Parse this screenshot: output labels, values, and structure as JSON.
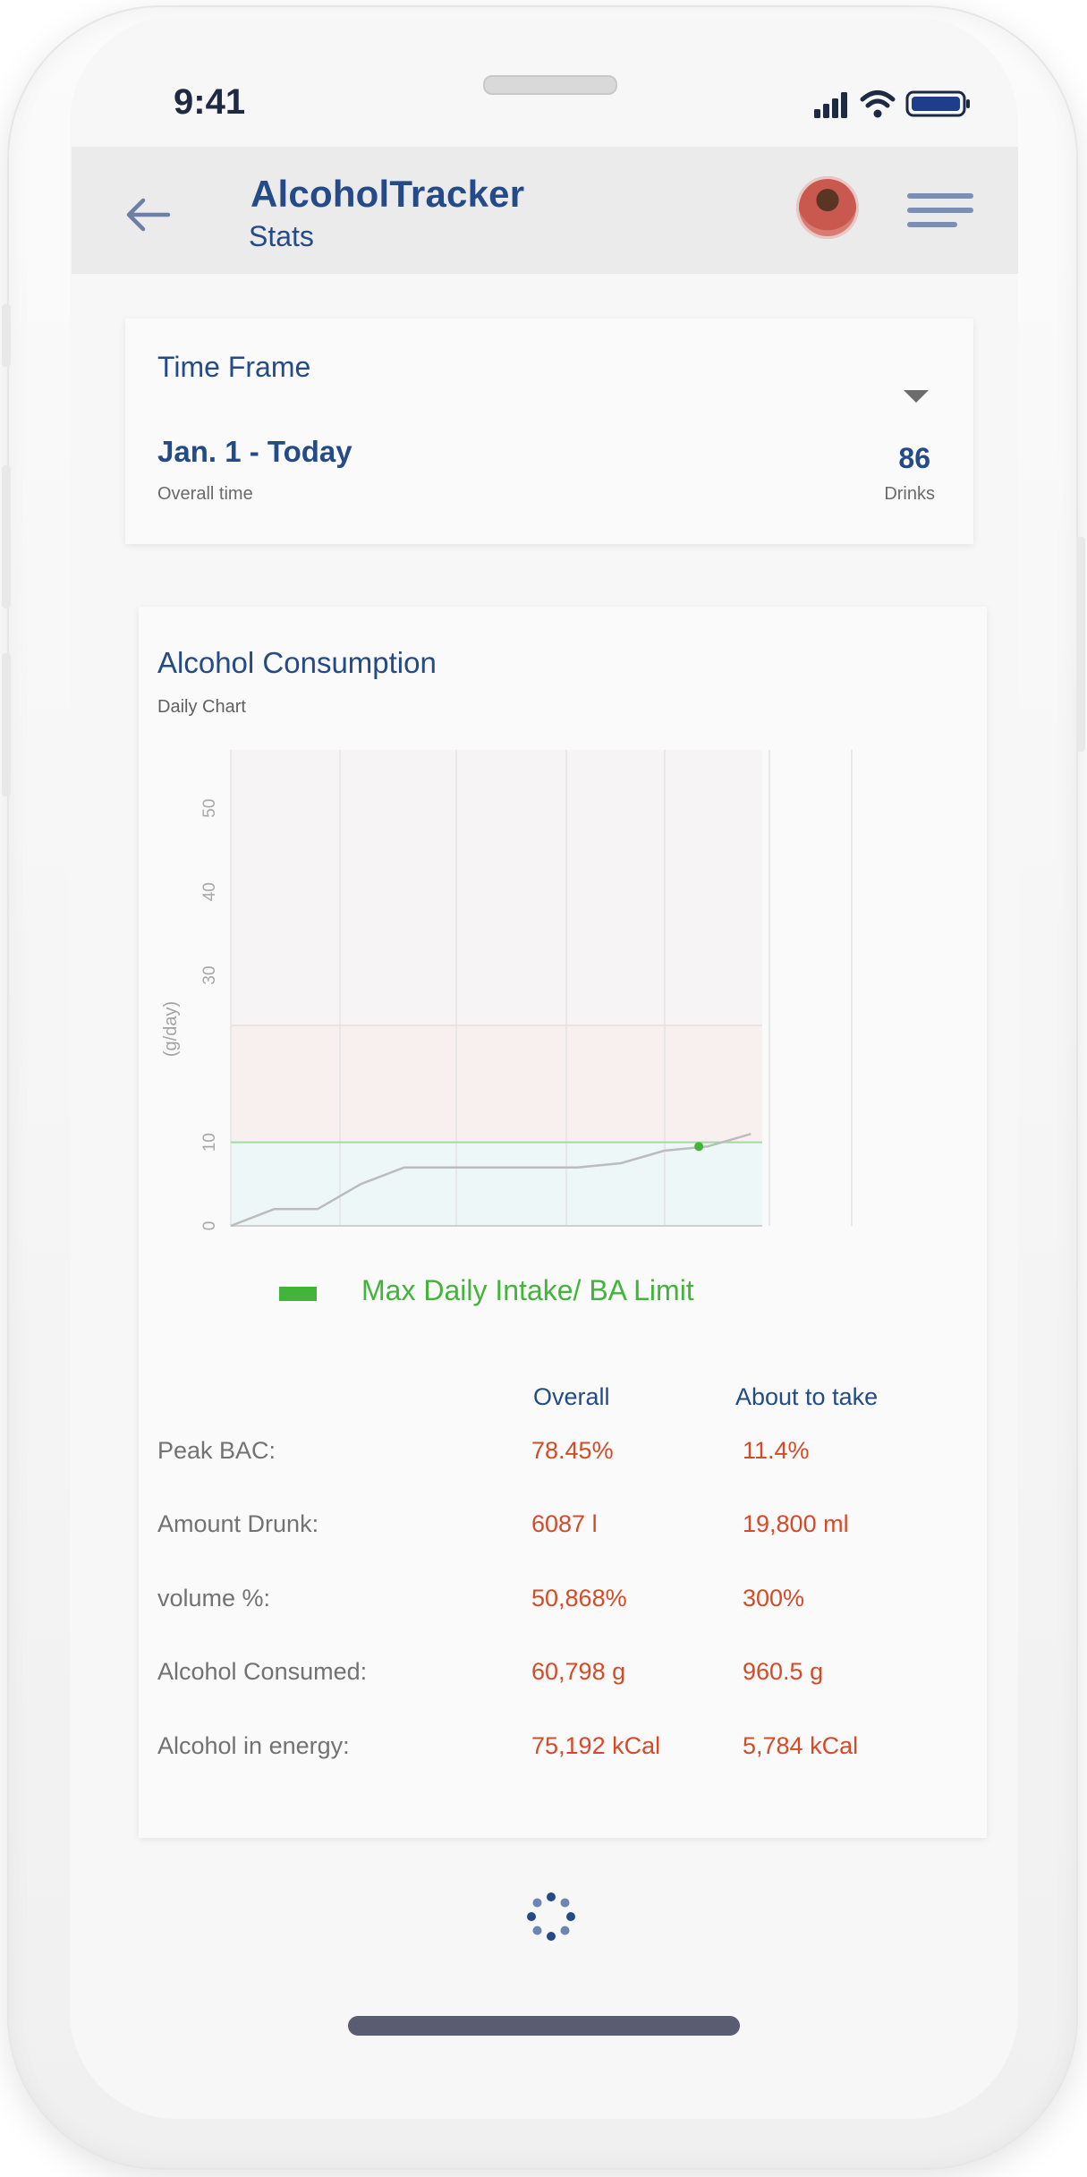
{
  "status_bar": {
    "time": "9:41"
  },
  "header": {
    "title": "AlcoholTracker",
    "subtitle": "Stats",
    "icons": [
      "back-arrow-icon",
      "avatar",
      "hamburger-menu-icon"
    ]
  },
  "time_frame": {
    "label": "Time Frame",
    "range": "Jan. 1 - Today",
    "range_caption": "Overall time",
    "count": "86",
    "count_caption": "Drinks"
  },
  "consumption": {
    "title": "Alcohol Consumption",
    "subtitle": "Daily Chart",
    "legend_label": "Max Daily Intake/ BA Limit",
    "legend_color": "#43b43a"
  },
  "chart_data": {
    "type": "line",
    "ylabel": "(g/day)",
    "yticks": [
      0,
      10,
      30,
      40,
      50
    ],
    "ylim": [
      0,
      57
    ],
    "limit_value": 10,
    "upper_band_value": 24,
    "x": [
      0,
      1,
      2,
      3,
      4,
      5,
      6,
      7,
      8,
      9,
      10,
      11,
      12
    ],
    "values": [
      0,
      2,
      2,
      5,
      7,
      7,
      7,
      7,
      7,
      7.5,
      9,
      9.5,
      11
    ],
    "highlight_point": {
      "x": 10.8,
      "y": 9.5
    },
    "grid": "vertical",
    "colors": {
      "line": "#bcbcbc",
      "limit_line": "#a6d8a1",
      "safe_band": "#eef7f8",
      "warning_band": "#f8efef",
      "point": "#43b43a"
    }
  },
  "stats_table": {
    "columns": [
      "Overall",
      "About to take"
    ],
    "rows": [
      {
        "label": "Peak BAC:",
        "overall": "78.45%",
        "about": "11.4%"
      },
      {
        "label": "Amount Drunk:",
        "overall": "6087 l",
        "about": "19,800 ml"
      },
      {
        "label": "volume %:",
        "overall": "50,868%",
        "about": "300%"
      },
      {
        "label": "Alcohol Consumed:",
        "overall": "60,798 g",
        "about": "960.5 g"
      },
      {
        "label": "Alcohol in energy:",
        "overall": "75,192 kCal",
        "about": "5,784 kCal"
      }
    ],
    "value_color": "#d54a27"
  }
}
